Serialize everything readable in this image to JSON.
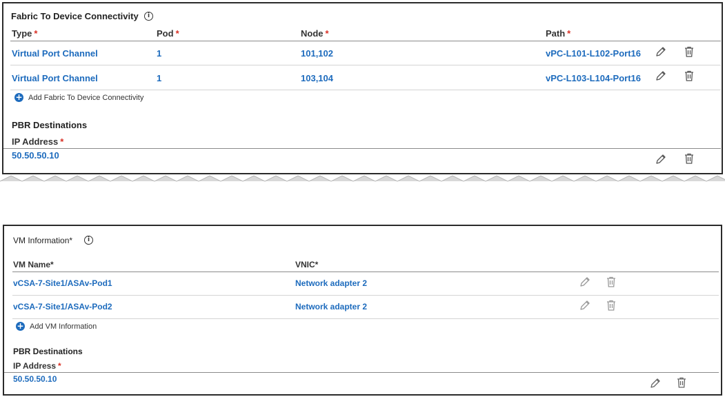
{
  "fabric": {
    "title": "Fabric To Device Connectivity",
    "info_glyph": "i",
    "headers": {
      "type": "Type",
      "pod": "Pod",
      "node": "Node",
      "path": "Path",
      "required_mark": "*"
    },
    "rows": [
      {
        "type": "Virtual Port Channel",
        "pod": "1",
        "node": "101,102",
        "path": "vPC-L101-L102-Port16"
      },
      {
        "type": "Virtual Port Channel",
        "pod": "1",
        "node": "103,104",
        "path": "vPC-L103-L104-Port16"
      }
    ],
    "add_label": "Add Fabric To Device Connectivity",
    "pbr": {
      "title": "PBR Destinations",
      "ip_header": "IP Address",
      "ip_value": "50.50.50.10"
    }
  },
  "vm": {
    "title": "VM Information*",
    "info_glyph": "i",
    "headers": {
      "vm_name": "VM Name*",
      "vnic": "VNIC*"
    },
    "rows": [
      {
        "vm_name": "vCSA-7-Site1/ASAv-Pod1",
        "vnic": "Network adapter 2"
      },
      {
        "vm_name": "vCSA-7-Site1/ASAv-Pod2",
        "vnic": "Network adapter 2"
      }
    ],
    "add_label": "Add VM Information",
    "pbr": {
      "title": "PBR Destinations",
      "ip_header": "IP Address",
      "ip_value": "50.50.50.10"
    }
  },
  "icons": {
    "edit": "pencil-icon",
    "delete": "trash-icon",
    "add": "plus-circle-icon",
    "info": "info-icon"
  },
  "colors": {
    "link": "#1d6bbd",
    "required": "#d93025",
    "border": "#2a2a2a"
  }
}
